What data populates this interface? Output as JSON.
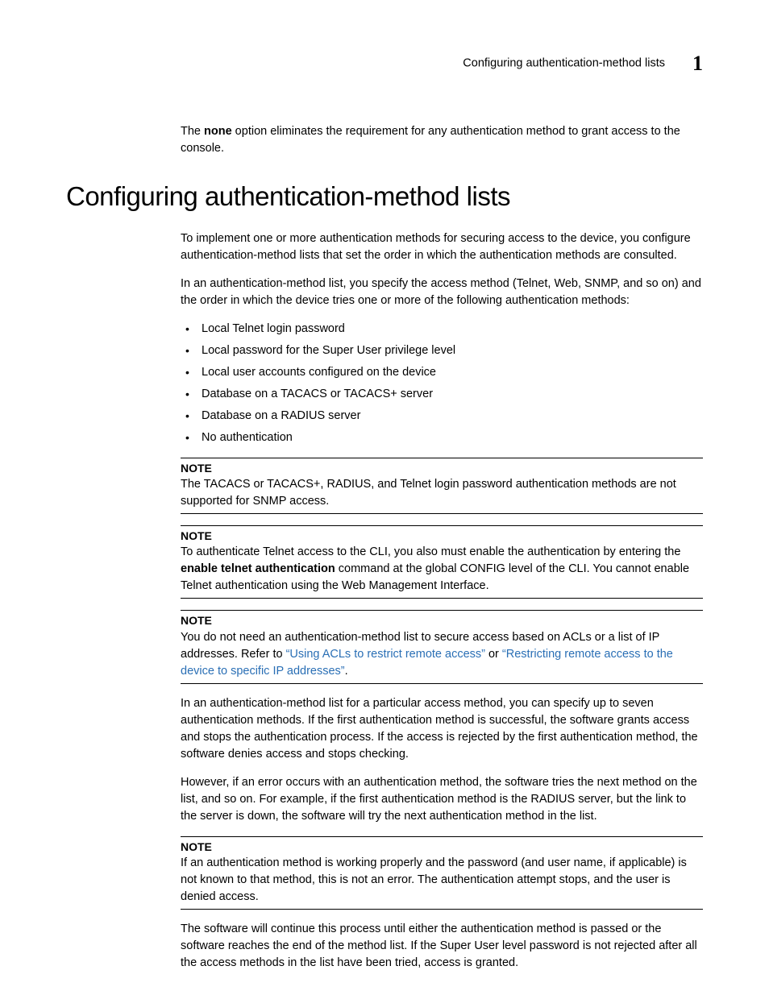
{
  "header": {
    "title": "Configuring authentication-method lists",
    "chapter": "1"
  },
  "intro": {
    "para1_prefix": "The ",
    "para1_bold": "none",
    "para1_suffix": " option eliminates the requirement for any authentication method to grant access to the console."
  },
  "section_heading": "Configuring authentication-method lists",
  "body": {
    "p1": "To implement one or more authentication methods for securing access to the device, you configure authentication-method lists that set the order in which the authentication methods are consulted.",
    "p2": "In an authentication-method list, you specify the access method (Telnet, Web, SNMP, and so on) and the order in which the device tries one or more of the following authentication methods:",
    "bullets": [
      "Local Telnet login password",
      "Local password for the Super User privilege level",
      "Local user accounts configured on the device",
      "Database on a TACACS or TACACS+ server",
      "Database on a RADIUS server",
      "No authentication"
    ]
  },
  "notes": {
    "label": "NOTE",
    "n1": "The TACACS or TACACS+, RADIUS, and Telnet login password authentication methods are not supported for SNMP access.",
    "n2_prefix": "To authenticate Telnet access to the CLI, you also must enable the authentication by entering the ",
    "n2_bold": "enable telnet authentication",
    "n2_suffix": " command at the global CONFIG level of the CLI. You cannot enable Telnet authentication using the Web Management Interface.",
    "n3_prefix": "You do not need an authentication-method list to secure access based on ACLs or a list of IP addresses. Refer to ",
    "n3_link1": "“Using ACLs to restrict remote access”",
    "n3_mid": " or ",
    "n3_link2": "“Restricting remote access to the device to specific IP addresses”",
    "n3_suffix": "."
  },
  "body2": {
    "p3": "In an authentication-method list for a particular access method, you can specify up to seven authentication methods. If the first authentication method is successful, the software grants access and stops the authentication process. If the access is rejected by the first authentication method, the software denies access and stops checking.",
    "p4": "However, if an error occurs with an authentication method, the software tries the next method on the list, and so on. For example, if the first authentication method is the RADIUS server, but the link to the server is down, the software will try the next authentication method in the list."
  },
  "note4": "If an authentication method is working properly and the password (and user name, if applicable) is not known to that method, this is not an error. The authentication attempt stops, and the user is denied access.",
  "body3": {
    "p5": "The software will continue this process until either the authentication method is passed or the software reaches the end of the method list. If the Super User level password is not rejected after all the access methods in the list have been tried, access is granted."
  }
}
